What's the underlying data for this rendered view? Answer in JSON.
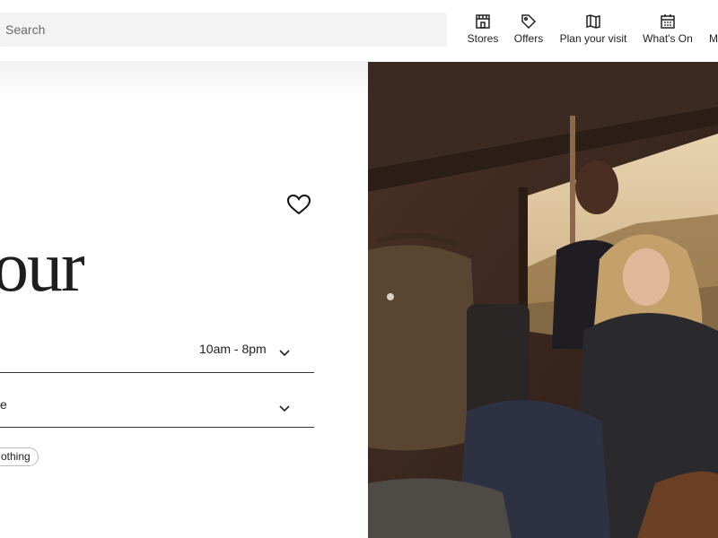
{
  "search": {
    "placeholder": "Search"
  },
  "nav": {
    "items": [
      {
        "label": "Stores",
        "icon": "storefront-icon"
      },
      {
        "label": "Offers",
        "icon": "tag-icon"
      },
      {
        "label": "Plan your visit",
        "icon": "map-icon"
      },
      {
        "label": "What's On",
        "icon": "calendar-icon"
      },
      {
        "label": "M",
        "icon": "more-icon"
      }
    ]
  },
  "main": {
    "title_partial": "our",
    "hours": "10am - 8pm",
    "select_partial": "e",
    "tag_partial": "othing"
  },
  "photo": {
    "alt": "Two people seated inside a vehicle with canvas bags"
  },
  "colors": {
    "text": "#222222",
    "search_bg": "#f3f3f3",
    "divider": "#333333"
  }
}
